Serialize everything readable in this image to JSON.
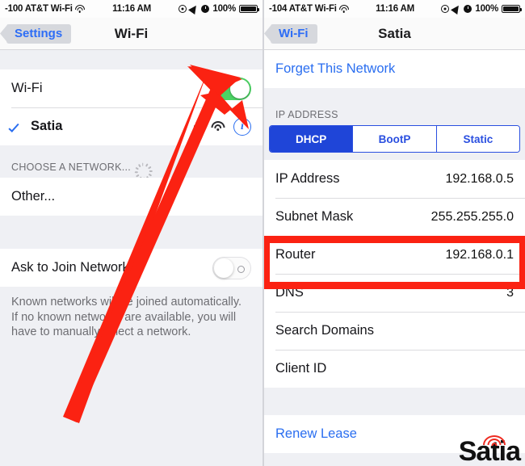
{
  "left": {
    "statusbar": {
      "signal": "-100 AT&T Wi-Fi",
      "wifi_icon": "wifi-icon",
      "time": "11:16 AM",
      "do_not_disturb_icon": "do-not-disturb-icon",
      "location_icon": "location-arrow-icon",
      "alarm_icon": "alarm-clock-icon",
      "battery_percent": "100%",
      "battery_icon": "battery-full-icon"
    },
    "nav": {
      "back_label": "Settings",
      "title": "Wi-Fi"
    },
    "wifi_row": {
      "label": "Wi-Fi",
      "toggle_state": "on"
    },
    "network_row": {
      "label": "Satia",
      "checkmark_icon": "checkmark-icon",
      "lock_icon": "lock-icon",
      "signal_icon": "wifi-signal-icon",
      "info_icon": "info-circle-icon",
      "info_glyph": "i"
    },
    "choose_header": {
      "label": "CHOOSE A NETWORK...",
      "spinner_icon": "loading-spinner-icon"
    },
    "other_row": {
      "label": "Other..."
    },
    "ask_row": {
      "label": "Ask to Join Networks",
      "toggle_state": "off"
    },
    "footnote": "Known networks will be joined automatically. If no known networks are available, you will have to manually select a network."
  },
  "right": {
    "statusbar": {
      "signal": "-104 AT&T Wi-Fi",
      "wifi_icon": "wifi-icon",
      "time": "11:16 AM",
      "do_not_disturb_icon": "do-not-disturb-icon",
      "location_icon": "location-arrow-icon",
      "alarm_icon": "alarm-clock-icon",
      "battery_percent": "100%",
      "battery_icon": "battery-full-icon"
    },
    "nav": {
      "back_label": "Wi-Fi",
      "title": "Satia"
    },
    "forget_row": {
      "label": "Forget This Network"
    },
    "ip_header": "IP ADDRESS",
    "segmented": {
      "options": [
        "DHCP",
        "BootP",
        "Static"
      ],
      "selected": "DHCP"
    },
    "detail_rows": [
      {
        "label": "IP Address",
        "value": "192.168.0.5"
      },
      {
        "label": "Subnet Mask",
        "value": "255.255.255.0"
      },
      {
        "label": "Router",
        "value": "192.168.0.1"
      },
      {
        "label": "DNS",
        "value": "3"
      },
      {
        "label": "Search Domains",
        "value": ""
      },
      {
        "label": "Client ID",
        "value": ""
      }
    ],
    "renew_row": {
      "label": "Renew Lease"
    },
    "logo": {
      "text": "Satia",
      "icon": "wifi-arcs-icon"
    }
  },
  "annotations": {
    "arrow": {
      "name": "red-pointer-arrow",
      "color": "#fb2212",
      "target": "info-circle-icon"
    },
    "highlight": {
      "name": "router-highlight-box",
      "color": "#fb2212",
      "target_row": "Router"
    }
  }
}
